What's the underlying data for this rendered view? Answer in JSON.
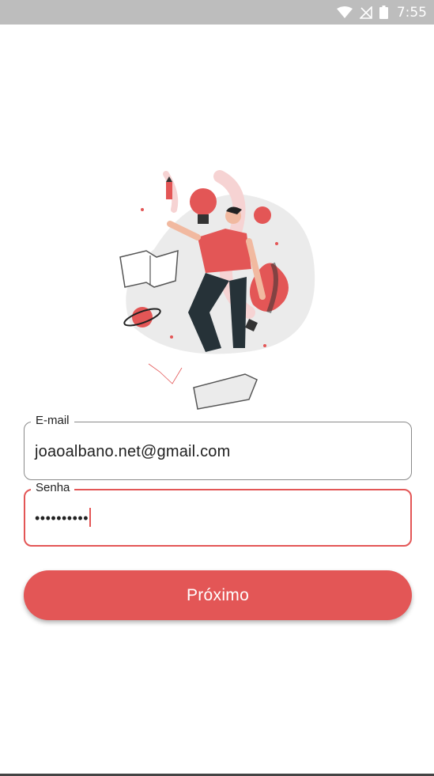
{
  "status_bar": {
    "time": "7:55",
    "icons": [
      "wifi-icon",
      "no-signal-icon",
      "battery-icon"
    ]
  },
  "illustration": {
    "icon": "person-floating-with-ideas-illustration"
  },
  "form": {
    "email": {
      "label": "E-mail",
      "value": "joaoalbano.net@gmail.com"
    },
    "password": {
      "label": "Senha",
      "value": "••••••••••",
      "focused": true
    }
  },
  "actions": {
    "next_label": "Próximo"
  },
  "colors": {
    "accent": "#e35656",
    "status_bar": "#bdbdbd",
    "text": "#212121"
  }
}
